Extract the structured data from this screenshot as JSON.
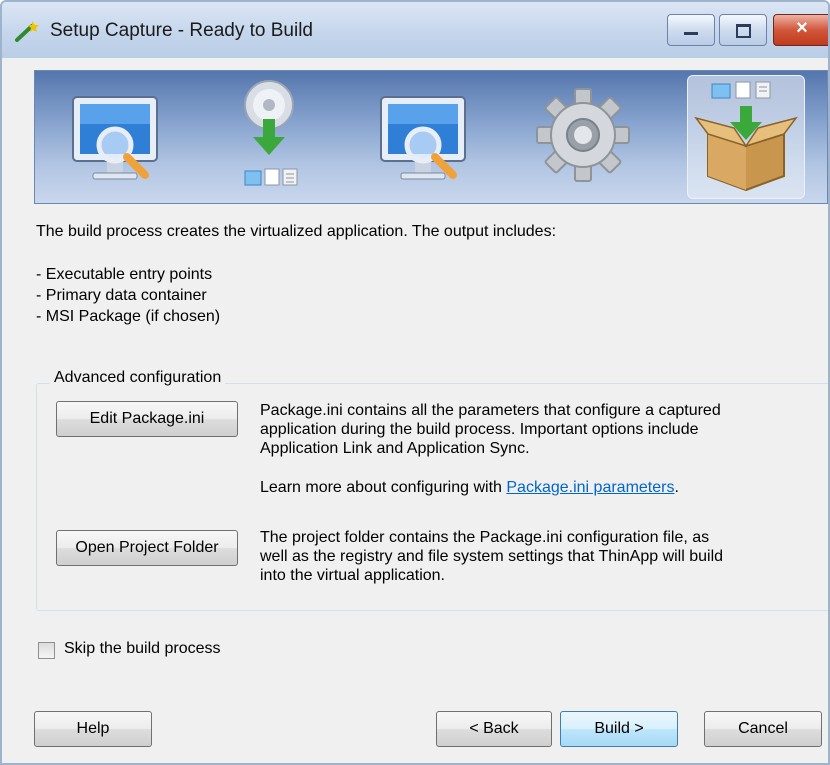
{
  "window": {
    "title": "Setup Capture - Ready to Build",
    "icon": "thinapp-wand-icon",
    "controls": {
      "minimize": "minimize-icon",
      "maximize": "maximize-icon",
      "close": "×"
    }
  },
  "wizard_steps": [
    {
      "icon": "monitor-magnifier-icon",
      "active": false
    },
    {
      "icon": "disc-install-icon",
      "active": false
    },
    {
      "icon": "monitor-magnifier-icon",
      "active": false
    },
    {
      "icon": "gear-icon",
      "active": false
    },
    {
      "icon": "package-box-icon",
      "active": true
    }
  ],
  "intro": "The build process creates the virtualized application. The output includes:",
  "outputs": [
    "- Executable entry points",
    "- Primary data container",
    "- MSI Package (if chosen)"
  ],
  "advanced": {
    "legend": "Advanced configuration",
    "edit_button": "Edit Package.ini",
    "edit_desc_lines": [
      "Package.ini contains all the parameters that configure a captured",
      "application during the build process. Important options include",
      "Application Link and Application Sync."
    ],
    "learn_prefix": "Learn more about configuring with ",
    "learn_link": "Package.ini parameters",
    "learn_suffix": ".",
    "open_button": "Open Project Folder",
    "open_desc_lines": [
      "The project folder contains the Package.ini configuration file, as",
      "well as the registry and file system settings that ThinApp will build",
      "into the virtual application."
    ]
  },
  "skip": {
    "label": "Skip the build process",
    "checked": false
  },
  "footer": {
    "help": "Help",
    "back": "< Back",
    "build": "Build >",
    "cancel": "Cancel"
  }
}
